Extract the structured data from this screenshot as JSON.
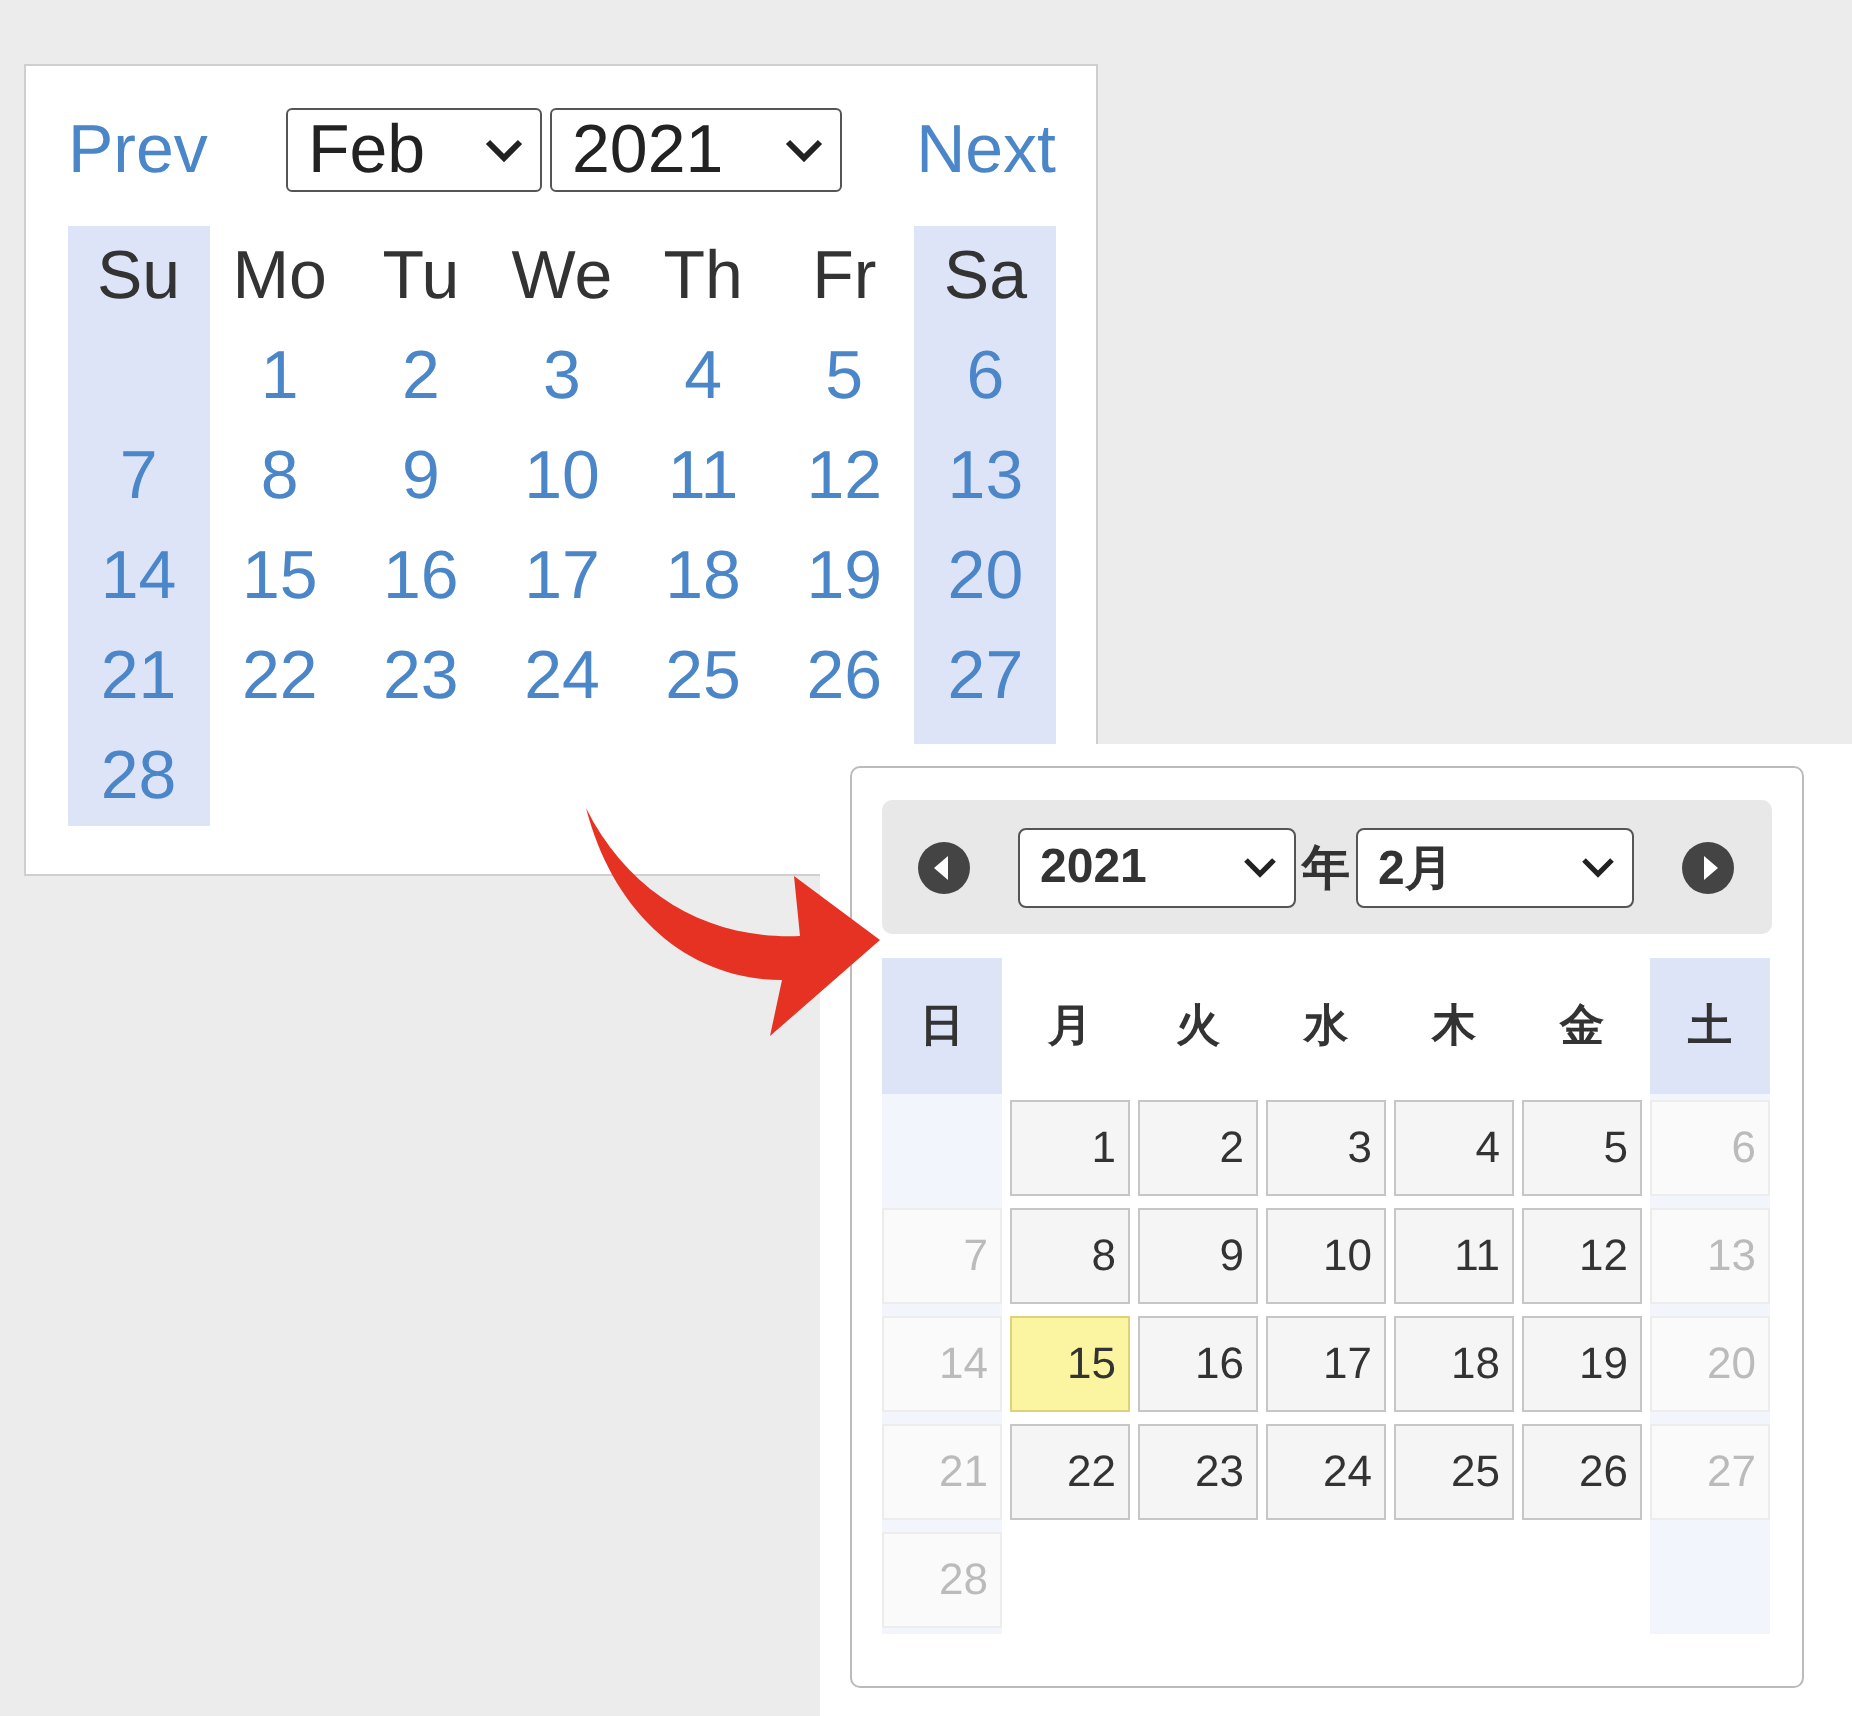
{
  "calendar_en": {
    "prev": "Prev",
    "next": "Next",
    "month": "Feb",
    "year": "2021",
    "weekdays": [
      {
        "label": "Su",
        "weekend": true
      },
      {
        "label": "Mo",
        "weekend": false
      },
      {
        "label": "Tu",
        "weekend": false
      },
      {
        "label": "We",
        "weekend": false
      },
      {
        "label": "Th",
        "weekend": false
      },
      {
        "label": "Fr",
        "weekend": false
      },
      {
        "label": "Sa",
        "weekend": true
      }
    ],
    "weeks": [
      [
        {
          "kind": "blank"
        },
        {
          "kind": "day",
          "day": "1"
        },
        {
          "kind": "day",
          "day": "2"
        },
        {
          "kind": "day",
          "day": "3"
        },
        {
          "kind": "day",
          "day": "4"
        },
        {
          "kind": "day",
          "day": "5"
        },
        {
          "kind": "day",
          "day": "6"
        }
      ],
      [
        {
          "kind": "day",
          "day": "7"
        },
        {
          "kind": "day",
          "day": "8"
        },
        {
          "kind": "day",
          "day": "9"
        },
        {
          "kind": "day",
          "day": "10"
        },
        {
          "kind": "day",
          "day": "11"
        },
        {
          "kind": "day",
          "day": "12"
        },
        {
          "kind": "day",
          "day": "13"
        }
      ],
      [
        {
          "kind": "day",
          "day": "14"
        },
        {
          "kind": "day",
          "day": "15"
        },
        {
          "kind": "day",
          "day": "16"
        },
        {
          "kind": "day",
          "day": "17"
        },
        {
          "kind": "day",
          "day": "18"
        },
        {
          "kind": "day",
          "day": "19"
        },
        {
          "kind": "day",
          "day": "20"
        }
      ],
      [
        {
          "kind": "day",
          "day": "21"
        },
        {
          "kind": "day",
          "day": "22"
        },
        {
          "kind": "day",
          "day": "23"
        },
        {
          "kind": "day",
          "day": "24"
        },
        {
          "kind": "day",
          "day": "25"
        },
        {
          "kind": "day",
          "day": "26"
        },
        {
          "kind": "day",
          "day": "27"
        }
      ],
      [
        {
          "kind": "day",
          "day": "28"
        },
        {
          "kind": "blank"
        },
        {
          "kind": "blank"
        },
        {
          "kind": "blank"
        },
        {
          "kind": "blank"
        },
        {
          "kind": "blank"
        },
        {
          "kind": "blank"
        }
      ]
    ]
  },
  "calendar_ja": {
    "year": "2021",
    "year_suffix": "年",
    "month": "2月",
    "weekdays": [
      {
        "label": "日",
        "weekend": true
      },
      {
        "label": "月",
        "weekend": false
      },
      {
        "label": "火",
        "weekend": false
      },
      {
        "label": "水",
        "weekend": false
      },
      {
        "label": "木",
        "weekend": false
      },
      {
        "label": "金",
        "weekend": false
      },
      {
        "label": "土",
        "weekend": true
      }
    ],
    "weeks": [
      [
        {
          "kind": "blank"
        },
        {
          "kind": "day",
          "day": "1",
          "disabled": false,
          "selected": false
        },
        {
          "kind": "day",
          "day": "2",
          "disabled": false,
          "selected": false
        },
        {
          "kind": "day",
          "day": "3",
          "disabled": false,
          "selected": false
        },
        {
          "kind": "day",
          "day": "4",
          "disabled": false,
          "selected": false
        },
        {
          "kind": "day",
          "day": "5",
          "disabled": false,
          "selected": false
        },
        {
          "kind": "day",
          "day": "6",
          "disabled": true,
          "selected": false
        }
      ],
      [
        {
          "kind": "day",
          "day": "7",
          "disabled": true,
          "selected": false
        },
        {
          "kind": "day",
          "day": "8",
          "disabled": false,
          "selected": false
        },
        {
          "kind": "day",
          "day": "9",
          "disabled": false,
          "selected": false
        },
        {
          "kind": "day",
          "day": "10",
          "disabled": false,
          "selected": false
        },
        {
          "kind": "day",
          "day": "11",
          "disabled": false,
          "selected": false
        },
        {
          "kind": "day",
          "day": "12",
          "disabled": false,
          "selected": false
        },
        {
          "kind": "day",
          "day": "13",
          "disabled": true,
          "selected": false
        }
      ],
      [
        {
          "kind": "day",
          "day": "14",
          "disabled": true,
          "selected": false
        },
        {
          "kind": "day",
          "day": "15",
          "disabled": false,
          "selected": true
        },
        {
          "kind": "day",
          "day": "16",
          "disabled": false,
          "selected": false
        },
        {
          "kind": "day",
          "day": "17",
          "disabled": false,
          "selected": false
        },
        {
          "kind": "day",
          "day": "18",
          "disabled": false,
          "selected": false
        },
        {
          "kind": "day",
          "day": "19",
          "disabled": false,
          "selected": false
        },
        {
          "kind": "day",
          "day": "20",
          "disabled": true,
          "selected": false
        }
      ],
      [
        {
          "kind": "day",
          "day": "21",
          "disabled": true,
          "selected": false
        },
        {
          "kind": "day",
          "day": "22",
          "disabled": false,
          "selected": false
        },
        {
          "kind": "day",
          "day": "23",
          "disabled": false,
          "selected": false
        },
        {
          "kind": "day",
          "day": "24",
          "disabled": false,
          "selected": false
        },
        {
          "kind": "day",
          "day": "25",
          "disabled": false,
          "selected": false
        },
        {
          "kind": "day",
          "day": "26",
          "disabled": false,
          "selected": false
        },
        {
          "kind": "day",
          "day": "27",
          "disabled": true,
          "selected": false
        }
      ],
      [
        {
          "kind": "day",
          "day": "28",
          "disabled": true,
          "selected": false
        },
        {
          "kind": "blank"
        },
        {
          "kind": "blank"
        },
        {
          "kind": "blank"
        },
        {
          "kind": "blank"
        },
        {
          "kind": "blank"
        },
        {
          "kind": "blank"
        }
      ]
    ]
  }
}
